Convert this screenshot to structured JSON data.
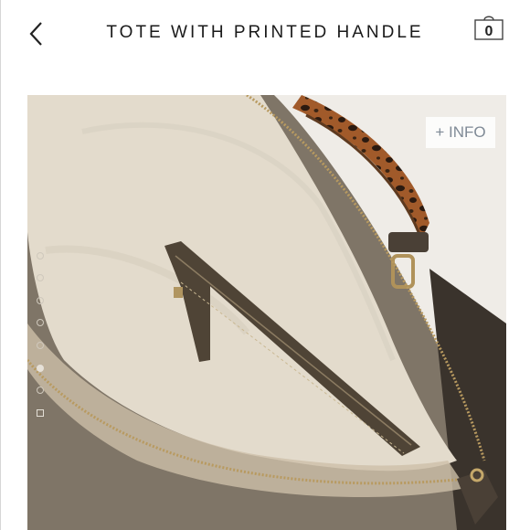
{
  "header": {
    "title": "TOTE WITH PRINTED HANDLE",
    "back_icon": "chevron-left-icon",
    "cart_icon": "shopping-bag-icon",
    "cart_count": "0"
  },
  "product_image": {
    "info_button": "+ INFO"
  },
  "gallery": {
    "items": [
      {
        "shape": "circle",
        "active": false
      },
      {
        "shape": "circle",
        "active": false
      },
      {
        "shape": "circle",
        "active": false
      },
      {
        "shape": "circle",
        "active": false
      },
      {
        "shape": "circle",
        "active": false
      },
      {
        "shape": "circle",
        "active": true
      },
      {
        "shape": "circle",
        "active": false
      },
      {
        "shape": "square",
        "active": false
      }
    ]
  },
  "colors": {
    "text": "#1a1a1a",
    "info_text": "#7f8a96",
    "lining": "#e6ded1",
    "bag_body": "#857b6e",
    "leopard": "#9a5428"
  }
}
